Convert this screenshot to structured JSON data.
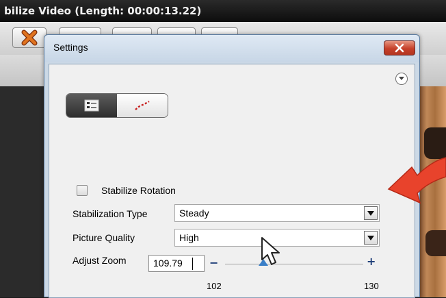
{
  "app": {
    "title": "bilize Video (Length: 00:00:13.22)"
  },
  "dialog": {
    "title": "Settings",
    "stabilize_rotation": {
      "label": "Stabilize Rotation",
      "checked": false
    },
    "stabilization_type": {
      "label": "Stabilization Type",
      "value": "Steady"
    },
    "picture_quality": {
      "label": "Picture Quality",
      "value": "High"
    },
    "adjust_zoom": {
      "label": "Adjust Zoom",
      "value": "109.79",
      "min_label": "102",
      "max_label": "130",
      "minus": "−",
      "plus": "+",
      "slider_value": 109.79,
      "slider_min": 102,
      "slider_max": 130
    }
  },
  "colors": {
    "accent_blue": "#1e3e78",
    "close_red": "#c6402a",
    "annotation_red": "#e8432c"
  },
  "icons": [
    "close-x-icon",
    "options-chevron-icon",
    "list-settings-icon",
    "motion-path-icon",
    "dropdown-arrow-icon",
    "mouse-pointer-icon",
    "annotation-arrow-icon"
  ]
}
